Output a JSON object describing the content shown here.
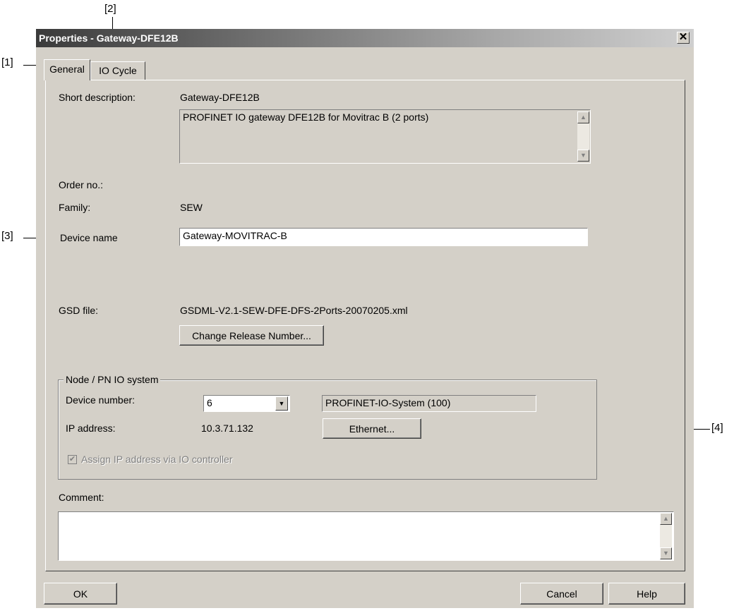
{
  "callouts": {
    "c1": "[1]",
    "c2": "[2]",
    "c3": "[3]",
    "c4": "[4]"
  },
  "window": {
    "title": "Properties - Gateway-DFE12B",
    "close_glyph": "✕"
  },
  "tabs": [
    {
      "label": "General",
      "active": true
    },
    {
      "label": "IO Cycle",
      "active": false
    }
  ],
  "general": {
    "short_description_label": "Short description:",
    "short_description_value": "Gateway-DFE12B",
    "description_text": "PROFINET IO gateway DFE12B for Movitrac B (2 ports)",
    "order_no_label": "Order no.:",
    "order_no_value": "",
    "family_label": "Family:",
    "family_value": "SEW",
    "device_name_label": "Device name",
    "device_name_value": "Gateway-MOVITRAC-B",
    "gsd_file_label": "GSD file:",
    "gsd_file_value": "GSDML-V2.1-SEW-DFE-DFS-2Ports-20070205.xml",
    "change_release_button": "Change Release Number..."
  },
  "node_group": {
    "title": "Node / PN IO system",
    "device_number_label": "Device number:",
    "device_number_value": "6",
    "io_system_value": "PROFINET-IO-System (100)",
    "ip_address_label": "IP address:",
    "ip_address_value": "10.3.71.132",
    "ethernet_button": "Ethernet...",
    "assign_ip_label": "Assign IP address via IO controller",
    "assign_ip_checked": true
  },
  "comment": {
    "label": "Comment:",
    "value": ""
  },
  "footer": {
    "ok": "OK",
    "cancel": "Cancel",
    "help": "Help"
  },
  "icons": {
    "scroll_up": "▲",
    "scroll_down": "▼",
    "dropdown_arrow": "▼",
    "check": "✔"
  }
}
